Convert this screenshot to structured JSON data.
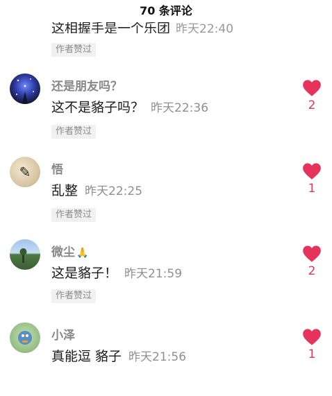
{
  "header": {
    "title": "70 条评论"
  },
  "partial_comment": {
    "text": "这相握手是一个乐团",
    "time": "昨天22:40",
    "badge": "作者赞过"
  },
  "comments": [
    {
      "name": "还是朋友吗？",
      "text": "这不是貉子吗？",
      "time": "昨天22:36",
      "badge": "作者赞过",
      "likes": "2",
      "avatar": "starry-night-avatar"
    },
    {
      "name": "悟",
      "text": "乱整",
      "time": "昨天22:25",
      "badge": "作者赞过",
      "likes": "1",
      "avatar": "calligraphy-avatar"
    },
    {
      "name": "微尘",
      "name_emoji": "🙏",
      "text": "这是貉子！",
      "time": "昨天21:59",
      "badge": "作者赞过",
      "likes": "2",
      "avatar": "landscape-avatar"
    },
    {
      "name": "小泽",
      "text": "真能逗 貉子",
      "time": "昨天21:56",
      "badge": "",
      "likes": "1",
      "avatar": "cartoon-avatar"
    }
  ],
  "colors": {
    "like": "#e6335b",
    "badge_bg": "#f1f1f1",
    "name": "#888888"
  }
}
